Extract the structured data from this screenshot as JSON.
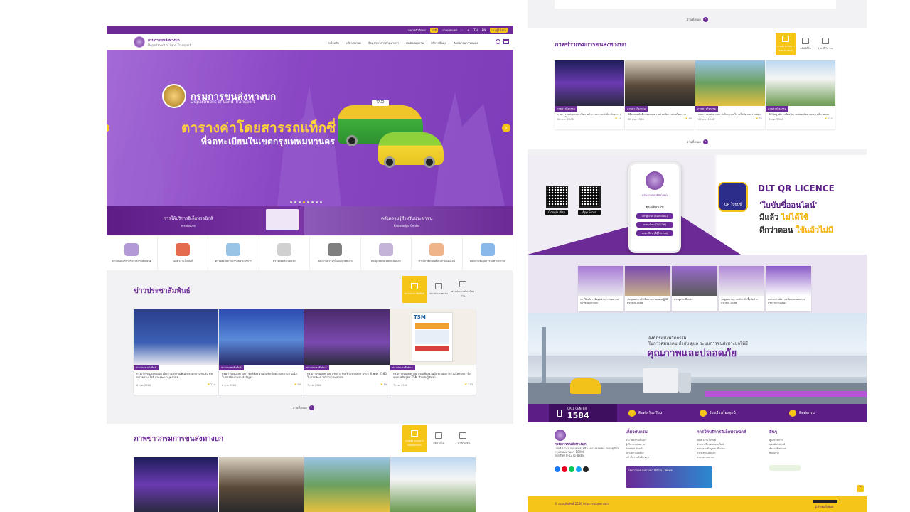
{
  "topbar": {
    "items": [
      "ขนาดตัวอักษร",
      "ปกติ",
      "การแสดงผล",
      "-",
      "+",
      "TH",
      "EN"
    ],
    "active_lang": "ไทย",
    "login": "เมนูผู้ใช้งาน"
  },
  "header": {
    "org_th": "กรมการขนส่งทางบก",
    "org_en": "Department of Land Transport",
    "nav": [
      "หน้าหลัก",
      "เกี่ยวกับกรม",
      "ข้อมูลข่าวสารตามมาตรา",
      "ติดต่อสอบถาม",
      "บริการข้อมูล",
      "ติดต่อกรมการขนส่ง"
    ]
  },
  "hero": {
    "org_th": "กรมการขนส่งทางบก",
    "org_en": "Department of Land Transport",
    "title": "ตารางค่าโดยสารรถแท็กซี่",
    "subtitle": "ที่จดทะเบียนในเขตกรุงเทพมหานคร",
    "taxi_sign": "TAXI"
  },
  "banners": [
    {
      "title": "การให้บริการอิเล็กทรอนิกส์",
      "sub": "e-services"
    },
    {
      "title": "คลังความรู้สำหรับประชาชน",
      "sub": "Knowledge Center"
    }
  ],
  "services": [
    "ตรวจสอบบริการรับชำระภาษีรถยนต์",
    "จองคิวงานใบขับขี่",
    "ตรวจสอบสถานะการขอรับบริการ",
    "ตรวจสอบทะเบียนรถ",
    "สอบถามความรู้ใบอนุญาตขับรถ",
    "ประมูลหมายเลขทะเบียนรถ",
    "ชำระภาษีรถยนต์ประจำปีออนไลน์",
    "สอบถามข้อมูลการจัดทำประกาศ"
  ],
  "news": {
    "title": "ข่าวประชาสัมพันธ์",
    "tabs": [
      "ข่าวประชาสัมพันธ์",
      "ข่าวประกาศกรม",
      "ข่าวประกาศรับสมัครงาน"
    ],
    "cards": [
      {
        "cat": "ข่าวประชาสัมพันธ์",
        "title": "กรมการขนส่งทางบก เปิดงานประชุมคณะกรรมการประเมิน ผล หน่วยงาน 1st และพัฒนาบุคลากร...",
        "date": "8 ก.ย. 2566",
        "views": "224"
      },
      {
        "cat": "ข่าวประชาสัมพันธ์",
        "title": "กรมการขนส่งทางบก จัดพิธีลงนามบันทึกข้อตกลงความร่วมมือ ในการจัดงานขนส่งสัญจร...",
        "date": "8 ก.ย. 2566",
        "views": "59"
      },
      {
        "cat": "ข่าวประชาสัมพันธ์",
        "title": "กรมการขนส่งทางบก รับรางวัลบริการภาครัฐ ประจำปี พ.ศ. 2566 ในการพัฒนาบริการประชาชน...",
        "date": "7 ก.ย. 2566",
        "views": "74"
      },
      {
        "cat": "ข่าวประชาสัมพันธ์",
        "title": "กรมการขนส่งทางบก ขอเชิญชวนผู้ประกอบการร่วมโครงการ ฝึกอบรมหลักสูตร TSM สำหรับผู้ขับรถ...",
        "date": "7 ก.ย. 2566",
        "views": "213"
      }
    ],
    "poster_label": "TSM",
    "more": "อ่านทั้งหมด"
  },
  "gallery": {
    "title": "ภาพข่าวกรมการขนส่งทางบก",
    "tabs": [
      "ภาพข่าวกรมการขนส่งทางบก",
      "คลิปวิดีโอ",
      "1 นาทีกับ ขบ."
    ],
    "cards": [
      {
        "cat": "ภาพข่าวกิจกรรม",
        "title": "กรมการขนส่งทางบก เปิดงานกิจกรรมการแข่งขัน ทักษะการขับขี่ ครั้งที่ 1",
        "date": "28 ส.ค. 2566",
        "views": "48"
      },
      {
        "cat": "ภาพข่าวกิจกรรม",
        "title": "พิธีลงนามบันทึกข้อตกลงความร่วมมือการส่งเสริมความปลอดภัยทางถนน ระหว่างหน่วยงาน...",
        "date": "28 ส.ค. 2566",
        "views": "46"
      },
      {
        "cat": "ภาพข่าวกิจกรรม",
        "title": "กรมการขนส่งทางบก จัดกิจกรรมบริจาคโลหิต และร่วมปลูกต้นไม้ เนื่องในโอกาส...",
        "date": "26 ส.ค. 2566",
        "views": "35"
      },
      {
        "cat": "ภาพข่าวกิจกรรม",
        "title": "พิธีเปิดศูนย์การเรียนรู้ความปลอดภัยทางถนน ภูมิภาคและสนามฝึกอบรม...",
        "date": "4 ส.ค. 2566",
        "views": "152"
      }
    ],
    "more": "อ่านทั้งหมด"
  },
  "qr": {
    "title": "DLT QR LICENCE",
    "line1": "'ใบขับขี่ออนไลน์'",
    "line2a": "มีแล้ว ",
    "line2b": "ไม่ได้ใช้",
    "line3a": "ดีกว่าตอน ",
    "line3b": "ใช้แล้วไม่มี",
    "phone_org": "กรมการขนส่งทางบก",
    "phone_welcome": "ยินดีต้อนรับ",
    "phone_btns": [
      "เข้าสู่ระบบ (ลงทะเบียน)",
      "ลงทะเบียน (ไม่มี QR)",
      "ลงทะเบียน (มีผู้ใช้ระบบ)"
    ],
    "stores": [
      "Google Play",
      "App Store"
    ],
    "app_label": "QR ใบขับขี่"
  },
  "mini_cards": [
    "การให้บริการข้อมูลข่าวสารของกรมการขนส่งทางบก",
    "ข้อมูลผลการดำเนินงานตามแผนปฏิบัติ ประจำปี 2566",
    "ประมูลทะเบียนรถ",
    "ข้อมูลสถานการณ์การจัดซื้อจัดจ้าง ประจำปี 2566",
    "สถานการณ์ความเสี่ยงและแผนการบริหารความเสี่ยง"
  ],
  "road": {
    "quote1": "องค์กรแห่งนวัตกรรม",
    "quote2": "ในการคมนาคม กำกับ ดูแล ระบบการขนส่งทางบกให้มี",
    "quote3": "คุณภาพและปลอดภัย"
  },
  "contact": {
    "call_label": "CALL CENTER",
    "call_number": "1584",
    "items": [
      "ติดต่อ ร้องเรียน",
      "ร้องเรียนร้องทุกข์",
      "ติดต่อกรม"
    ]
  },
  "footer": {
    "org": "กรมการขนส่งทางบก",
    "address": "เลขที่ 1032 ถนนพหลโยธิน แขวงจอมพล เขตจตุจักร กรุงเทพมหานคร 10900",
    "phone": "โทรศัพท์ 0-2271-8888",
    "cols": [
      {
        "title": "เกี่ยวกับกรม",
        "items": [
          "ประวัติความเป็นมา",
          "ผู้บริหารหน่วยงาน",
          "วิสัยทัศน์ พันธกิจ",
          "โครงสร้างองค์กร",
          "หน้าที่ความรับผิดชอบ"
        ]
      },
      {
        "title": "การให้บริการอิเล็กทรอนิกส์",
        "items": [
          "จองคิวงานใบขับขี่",
          "ชำระภาษีรถยนต์ออนไลน์",
          "ตรวจสอบข้อมูลทะเบียนรถ",
          "ประมูลทะเบียนรถ",
          "ตรวจสอบสถานะ"
        ]
      },
      {
        "title": "อื่นๆ",
        "items": [
          "ศูนย์ราชการ",
          "แผนผังเว็บไซต์",
          "คำถามที่พบบ่อย",
          "ติดต่อเรา"
        ]
      }
    ],
    "newsletter": "กรมการขนส่งทางบก PR DLT News",
    "copyright": "© สงวนลิขสิทธิ์ 2566 กรมการขนส่งทางบก",
    "visitors": "ผู้เข้าชมทั้งหมด"
  },
  "colors": {
    "primary": "#6b2a96",
    "accent": "#f5c518",
    "hero_top": "#a46ad6"
  }
}
